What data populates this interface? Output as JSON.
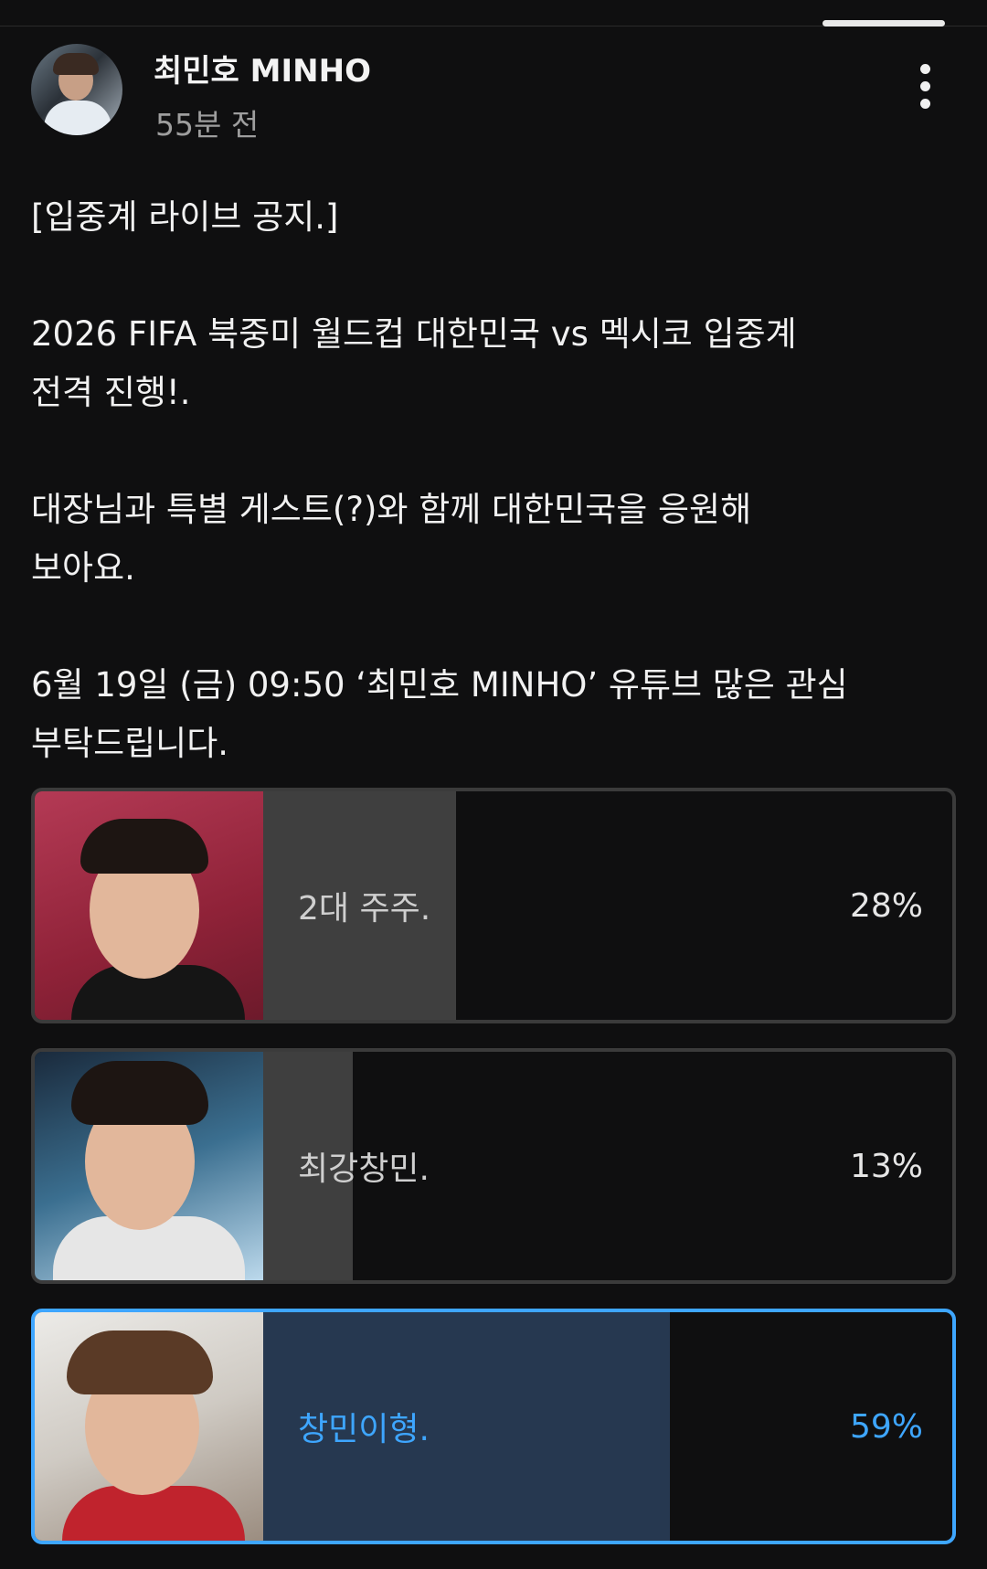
{
  "post": {
    "author": "최민호 MINHO",
    "time": "55분 전",
    "text": "[입중계 라이브 공지.]\n\n2026 FIFA 북중미 월드컵 대한민국 vs 멕시코 입중계\n전격 진행!.\n\n대장님과 특별 게스트(?)와 함께 대한민국을 응원해\n보아요.\n\n6월 19일 (금) 09:50 ‘최민호 MINHO’ 유튜브 많은 관심\n부탁드립니다."
  },
  "poll": {
    "options": [
      {
        "label": "2대 주주.",
        "percent": "28%",
        "value": 28,
        "selected": false
      },
      {
        "label": "최강창민.",
        "percent": "13%",
        "value": 13,
        "selected": false
      },
      {
        "label": "창민이형.",
        "percent": "59%",
        "value": 59,
        "selected": true
      }
    ]
  },
  "colors": {
    "background": "#0f0f10",
    "accent": "#3ea6ff",
    "fill_default": "#3f3f3f",
    "fill_selected": "#263850"
  },
  "icons": {
    "more": "more-vertical-icon"
  }
}
